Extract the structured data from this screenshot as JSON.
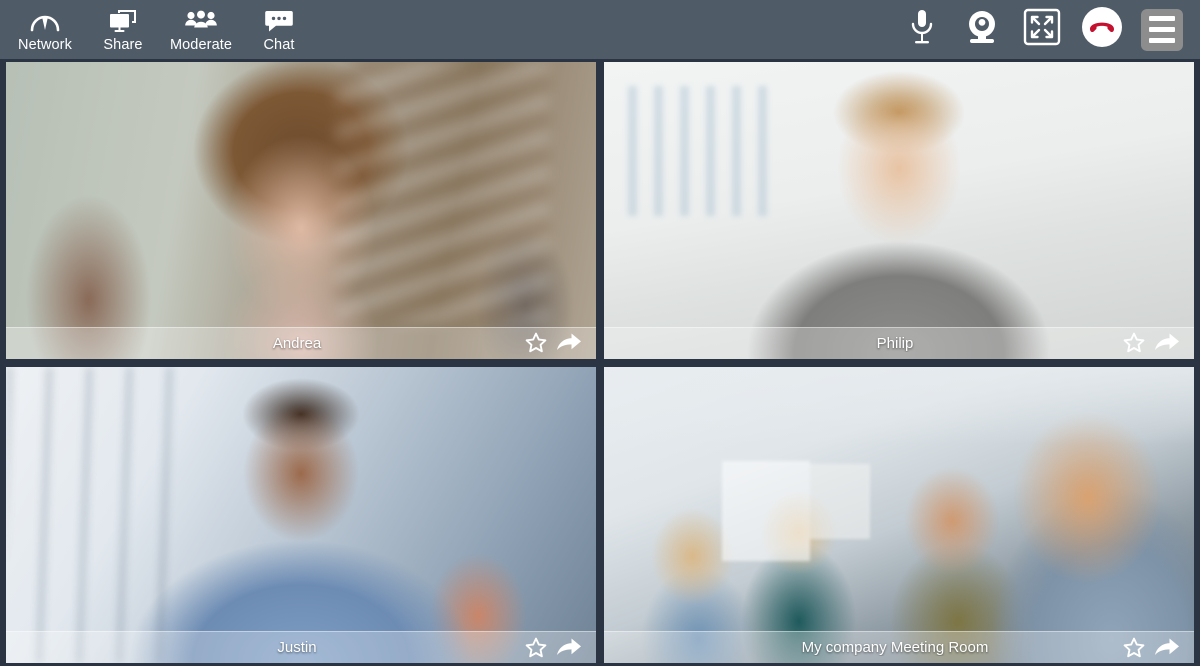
{
  "toolbar": {
    "left_buttons": [
      {
        "label": "Network",
        "icon": "network-gauge-icon"
      },
      {
        "label": "Share",
        "icon": "screen-share-icon"
      },
      {
        "label": "Moderate",
        "icon": "people-group-icon"
      },
      {
        "label": "Chat",
        "icon": "chat-bubble-icon"
      }
    ],
    "right_buttons": [
      {
        "name": "microphone-icon",
        "title": "Microphone"
      },
      {
        "name": "webcam-icon",
        "title": "Webcam"
      },
      {
        "name": "fullscreen-icon",
        "title": "Fullscreen"
      },
      {
        "name": "hangup-icon",
        "title": "Hang up"
      },
      {
        "name": "menu-icon",
        "title": "Menu"
      }
    ],
    "colors": {
      "background": "#505b68",
      "icon": "#ffffff",
      "hangup_circle": "#ffffff",
      "hangup_handset": "#c4112f",
      "menu_button_bg": "#8d8d8d",
      "divider": "#2b3442"
    }
  },
  "grid": {
    "columns": 2,
    "rows": 2,
    "tiles": [
      {
        "name": "Andrea",
        "actions": {
          "favorite": "star-icon",
          "share": "share-arrow-icon"
        }
      },
      {
        "name": "Philip",
        "actions": {
          "favorite": "star-icon",
          "share": "share-arrow-icon"
        }
      },
      {
        "name": "Justin",
        "actions": {
          "favorite": "star-icon",
          "share": "share-arrow-icon"
        }
      },
      {
        "name": "My company Meeting Room",
        "actions": {
          "favorite": "star-icon",
          "share": "share-arrow-icon"
        }
      }
    ]
  }
}
